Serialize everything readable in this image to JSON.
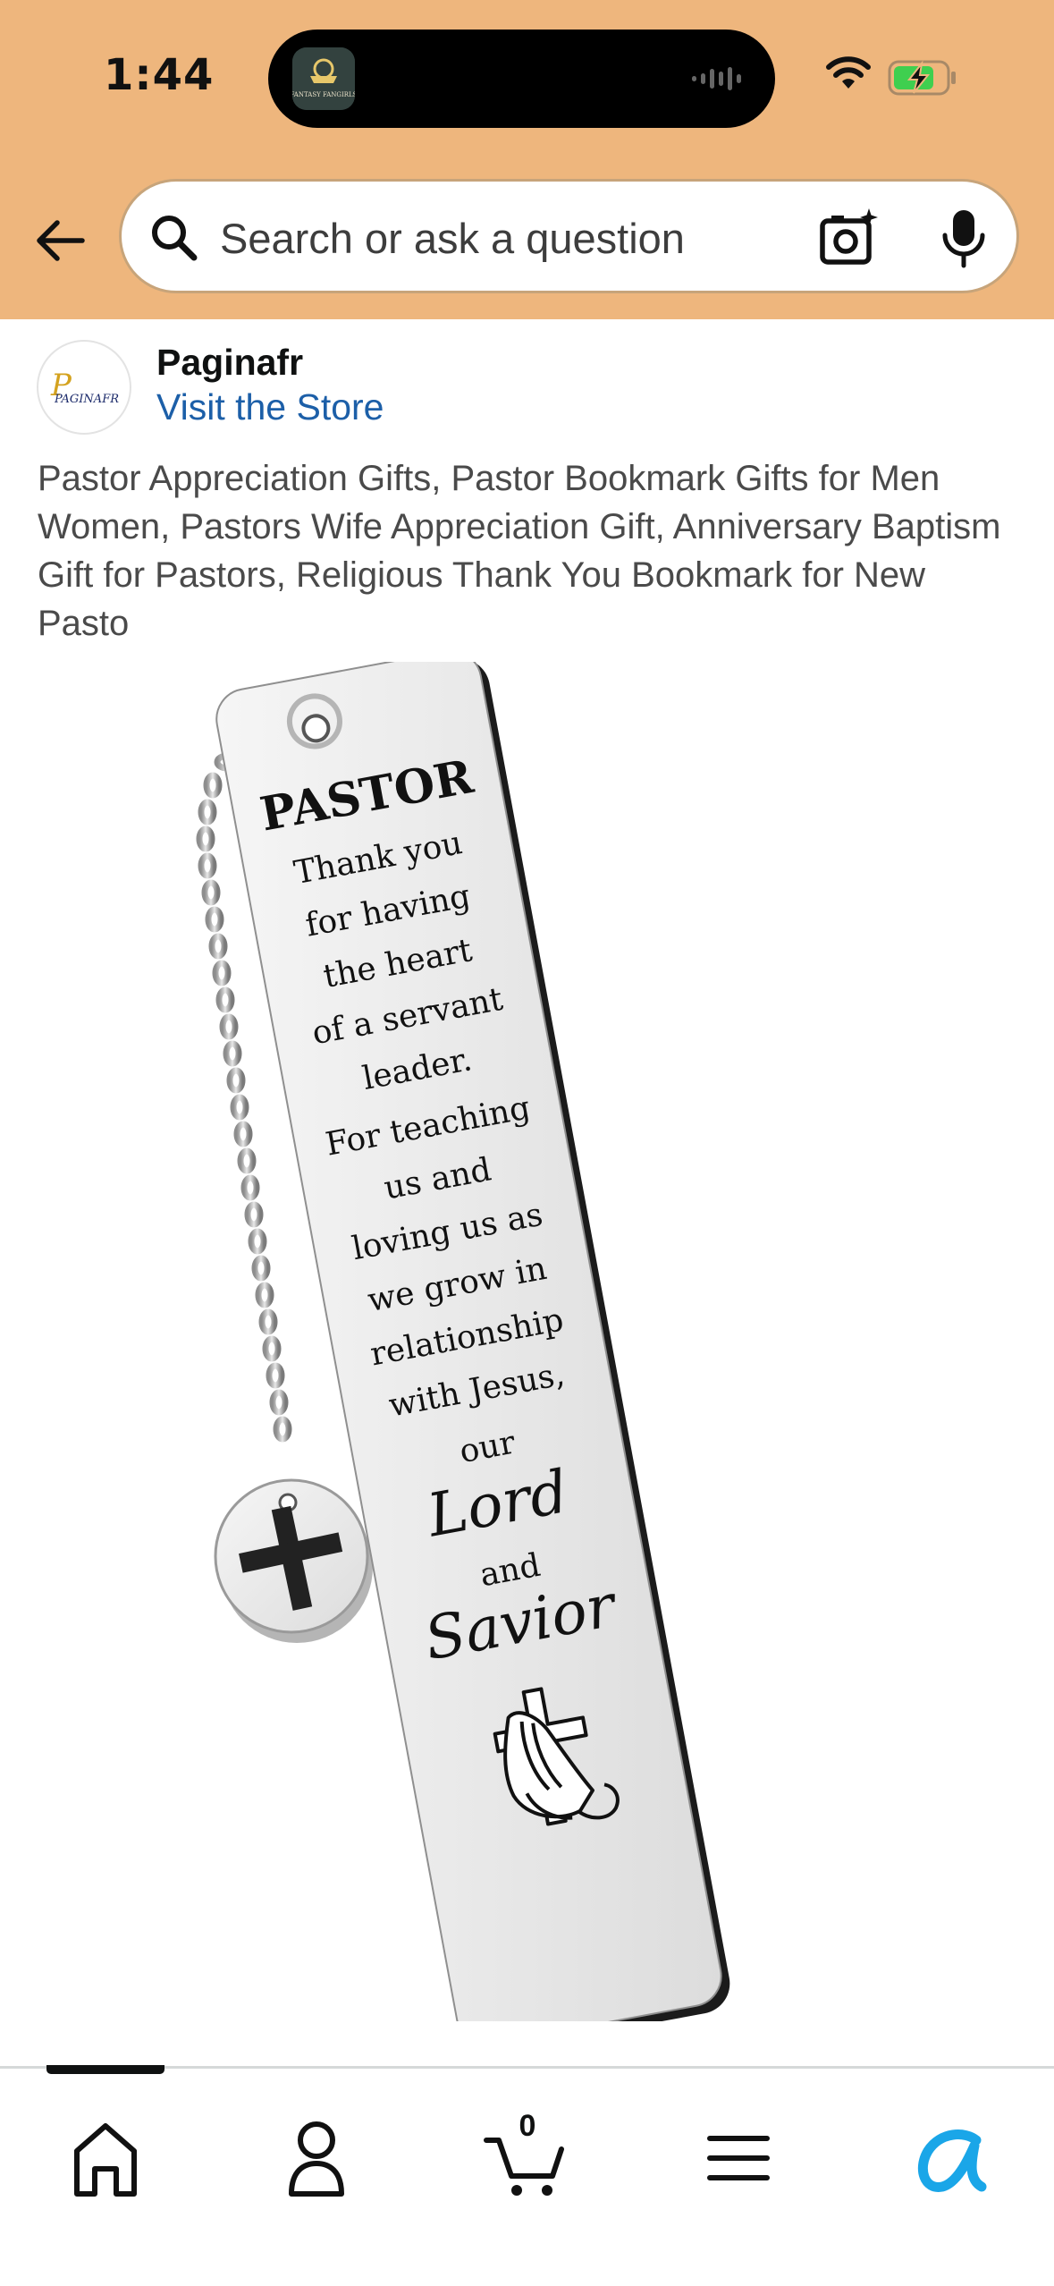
{
  "status_bar": {
    "time": "1:44",
    "island_app_name": "FANTASY FANGIRLS",
    "icons": [
      "wifi-icon",
      "battery-charging-icon"
    ]
  },
  "search": {
    "placeholder": "Search or ask a question",
    "icons": [
      "back-arrow-icon",
      "search-icon",
      "camera-icon",
      "mic-icon"
    ]
  },
  "store": {
    "logo_text": "PAGINAFR",
    "name": "Paginafr",
    "link_label": "Visit the Store"
  },
  "product": {
    "title": "Pastor Appreciation Gifts, Pastor Bookmark Gifts for Men Women, Pastors Wife Appreciation Gift, Anniversary Baptism Gift for Pastors, Religious Thank You Bookmark for New Pasto",
    "bookmark": {
      "heading": "PASTOR",
      "lines": [
        "Thank you",
        "for having",
        "the heart",
        "of a servant",
        "leader.",
        "For teaching",
        "us and",
        "loving us as",
        "we grow in",
        "relationship",
        "with Jesus,",
        "our"
      ],
      "script_lines": [
        "Lord",
        "and",
        "Savior"
      ]
    }
  },
  "tabbar": {
    "active_tab": "home",
    "tabs": [
      "home-icon",
      "account-icon",
      "cart-icon",
      "menu-icon",
      "rufus-icon"
    ],
    "cart_count": "0"
  },
  "colors": {
    "header_bg": "#eeb67d",
    "link": "#1c5fa8",
    "rufus_accent": "#1aa6e8"
  }
}
